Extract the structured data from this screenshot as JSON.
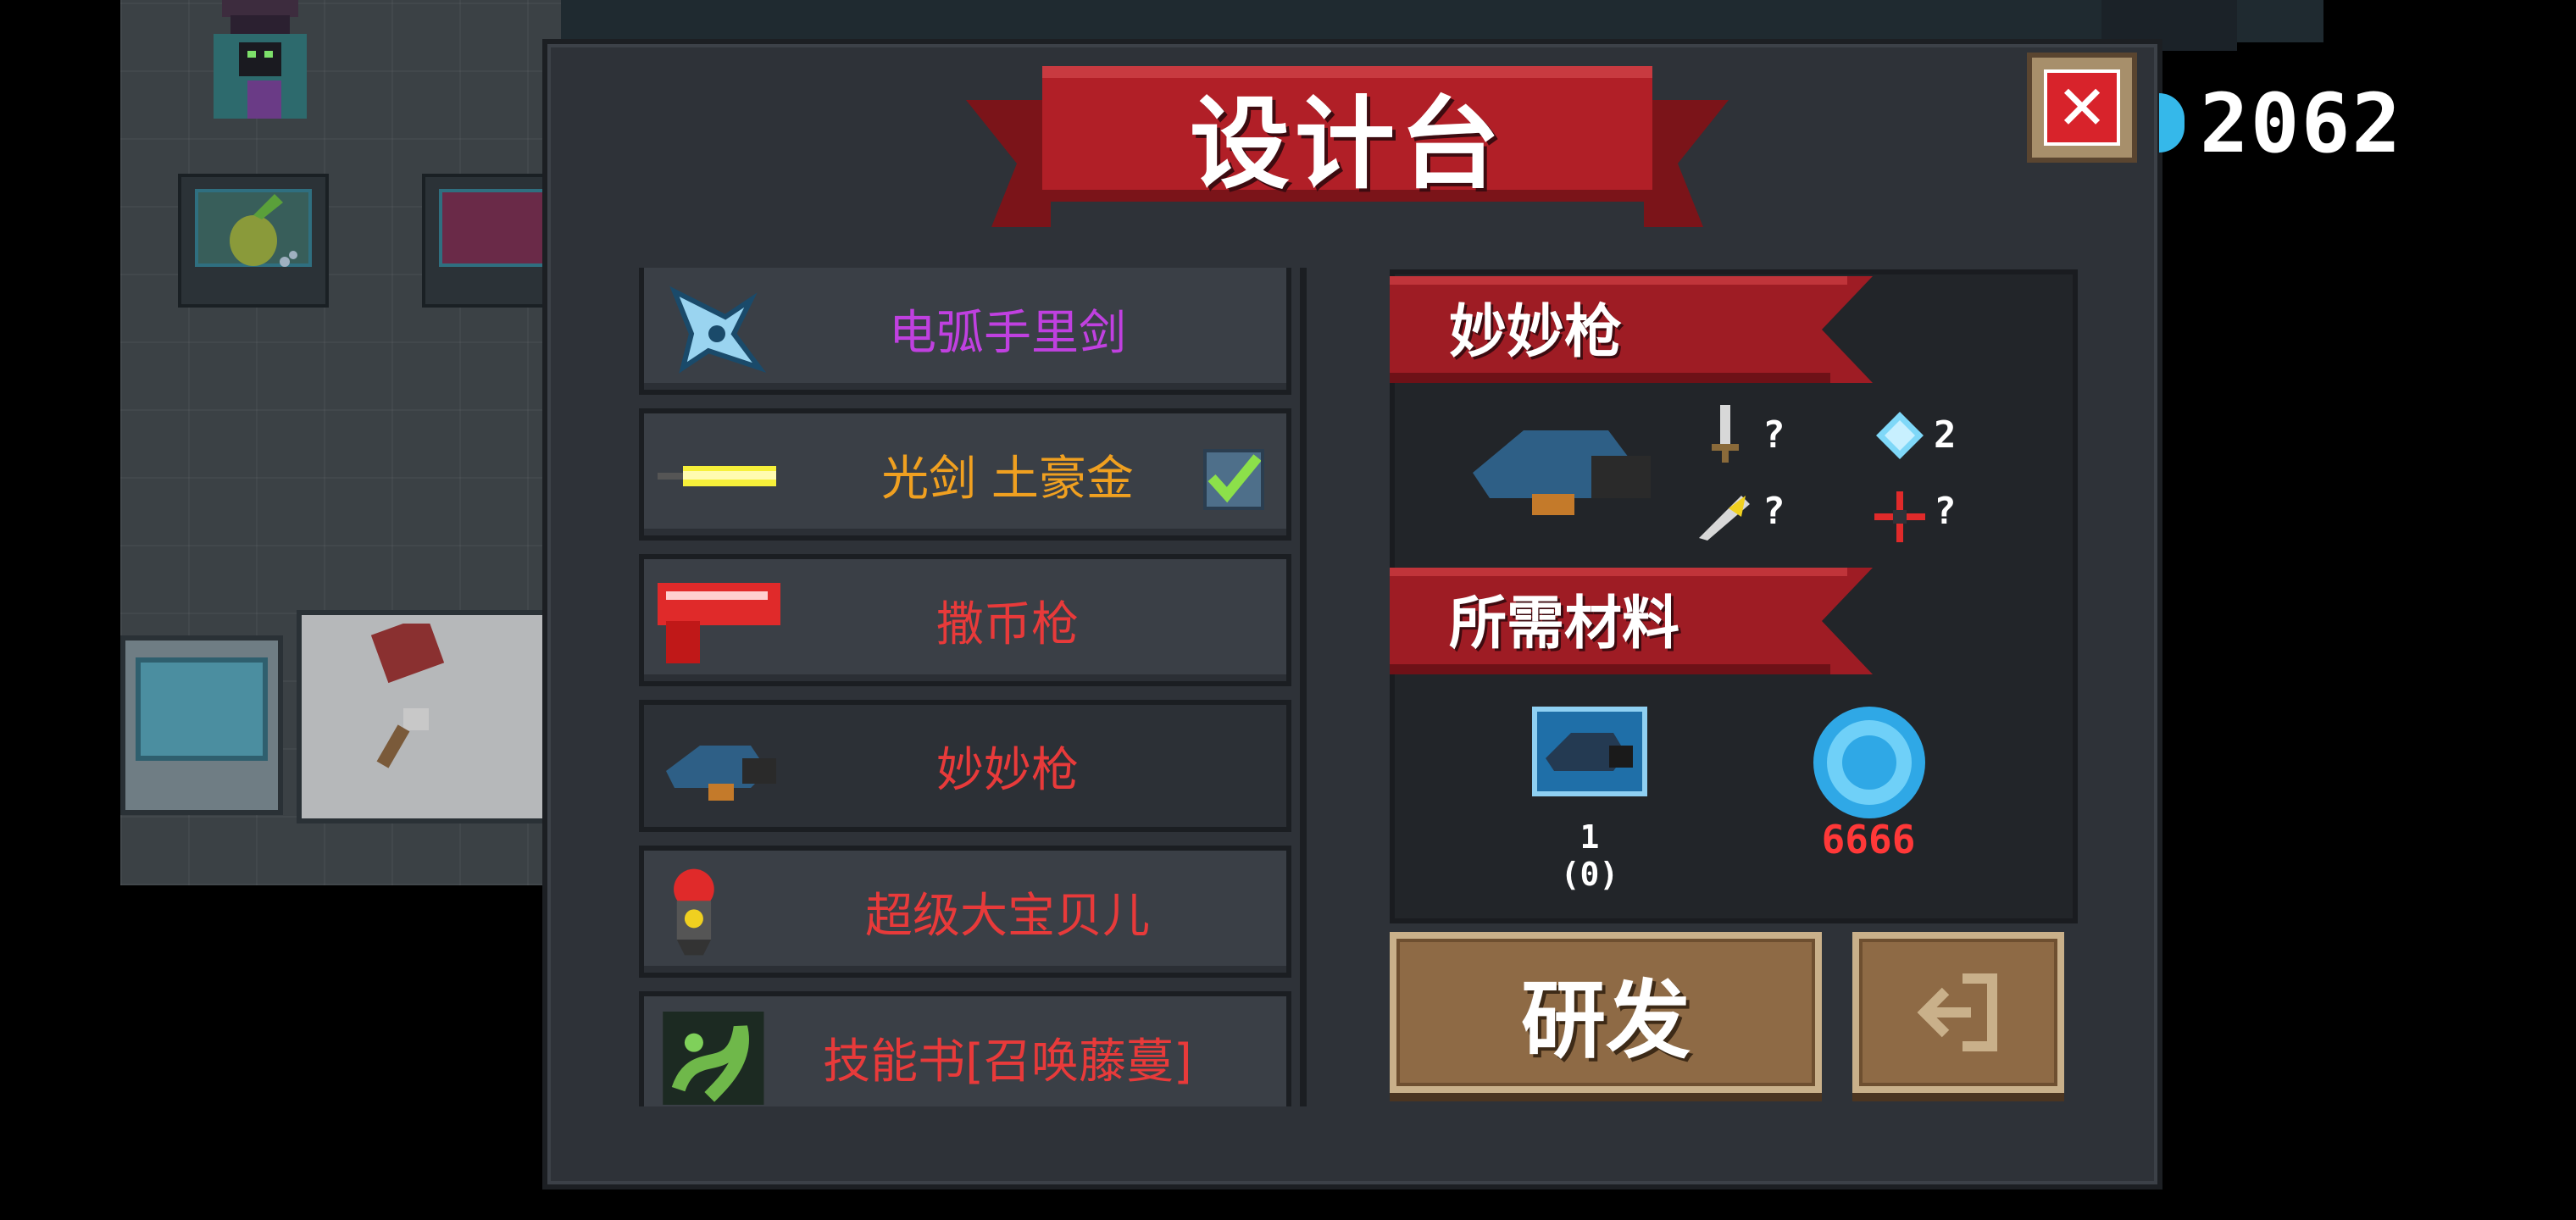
{
  "currency": {
    "icon": "gem-icon",
    "count": "2062",
    "color": "#35b8ea"
  },
  "dialog": {
    "title": "设计台",
    "close_icon": "close-icon",
    "list": {
      "items": [
        {
          "label": "电弧手里剑",
          "icon": "shuriken-icon",
          "color": "#c040e0",
          "checked": false
        },
        {
          "label": "光剑 土豪金",
          "icon": "lightsaber-icon",
          "color": "#f0a020",
          "checked": true
        },
        {
          "label": "撒币枪",
          "icon": "coin-gun-icon",
          "color": "#e83a3a",
          "checked": false
        },
        {
          "label": "妙妙枪",
          "icon": "cat-gun-icon",
          "color": "#e83a3a",
          "checked": false,
          "selected": true
        },
        {
          "label": "超级大宝贝儿",
          "icon": "nuke-icon",
          "color": "#e83a3a",
          "checked": false
        },
        {
          "label": "技能书[召唤藤蔓]",
          "icon": "vine-book-icon",
          "color": "#e83a3a",
          "checked": false
        }
      ]
    },
    "detail": {
      "name": "妙妙枪",
      "stats": {
        "damage": "?",
        "energy": "2",
        "crit": "?",
        "accuracy": "?"
      },
      "materials_title": "所需材料",
      "materials": [
        {
          "icon": "blueprint-cat-gun-icon",
          "count_top": "1",
          "count_bottom": "(0)"
        },
        {
          "icon": "gem-icon",
          "cost": "6666"
        }
      ]
    },
    "buttons": {
      "research": "研发",
      "exit_icon": "exit-icon"
    }
  }
}
